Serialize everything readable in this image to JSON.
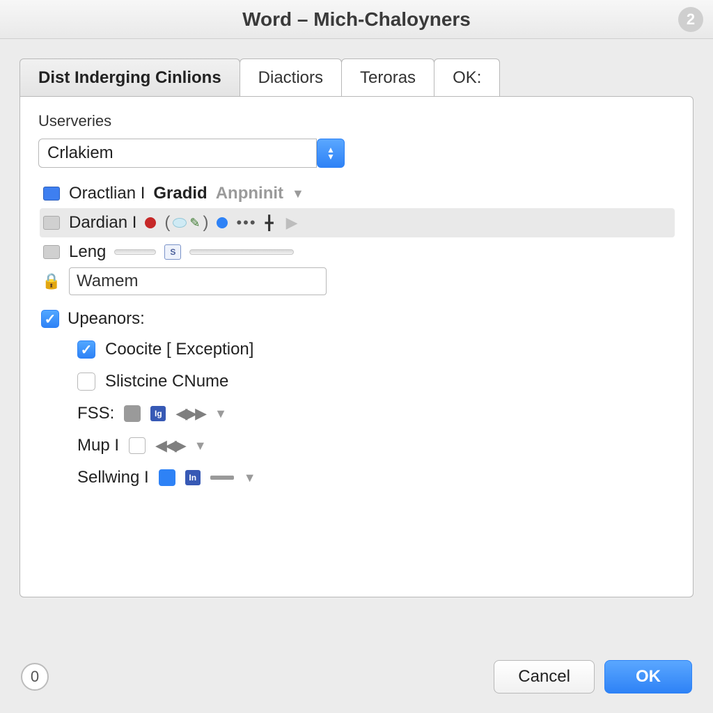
{
  "titlebar": {
    "title": "Word – Mich-Chaloyners",
    "right_badge": "2"
  },
  "tabs": [
    {
      "label": "Dist Inderging Cinlions",
      "active": true
    },
    {
      "label": "Diactiors",
      "active": false
    },
    {
      "label": "Teroras",
      "active": false
    },
    {
      "label": "OK:",
      "active": false
    }
  ],
  "panel": {
    "section_label": "Userveries",
    "combo_value": "Crlakiem",
    "rows": {
      "r1": {
        "text_a": "Oractlian I",
        "text_b": "Gradid",
        "text_c": "Anpninit"
      },
      "r2": {
        "text": "Dardian I"
      },
      "r3": {
        "text": "Leng",
        "mini": "S"
      },
      "r4": {
        "value": "Wamem"
      }
    },
    "upeanors": {
      "label": "Upeanors:",
      "checked": true,
      "items": {
        "coocite": {
          "label": "Coocite [ Exception]",
          "checked": true
        },
        "slistcine": {
          "label": "Slistcine CNume",
          "checked": false
        },
        "fss": {
          "label": "FSS:",
          "badge": "Ig"
        },
        "mup": {
          "label": "Mup I"
        },
        "sellwing": {
          "label": "Sellwing I",
          "badge": "In"
        }
      }
    }
  },
  "footer": {
    "counter": "0",
    "cancel": "Cancel",
    "ok": "OK"
  }
}
